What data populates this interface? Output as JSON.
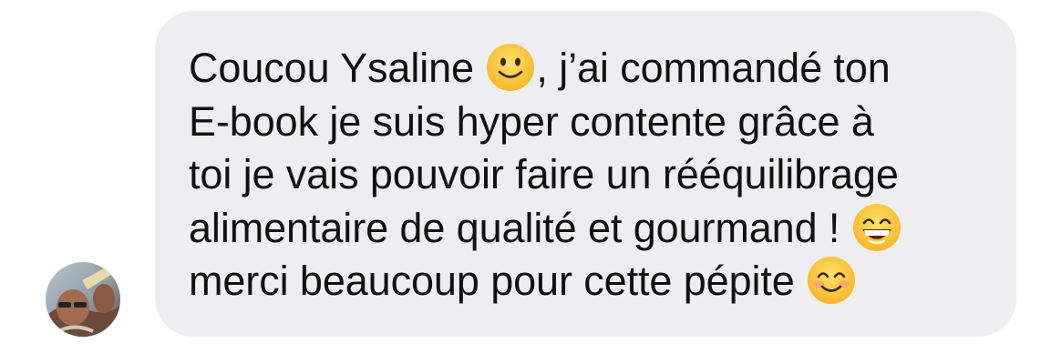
{
  "message": {
    "lines": [
      {
        "before": "Coucou Ysaline ",
        "emoji": "slightly-smiling-face",
        "after": ", j’ai commandé ton"
      },
      {
        "text": "E-book je suis hyper contente grâce à"
      },
      {
        "text": "toi je vais pouvoir faire un rééquilibrage"
      },
      {
        "before": "alimentaire de qualité et gourmand ! ",
        "emoji": "grinning-face-with-smiling-eyes",
        "after": ""
      },
      {
        "before": "merci beaucoup pour cette pépite ",
        "emoji": "smiling-face-with-smiling-eyes",
        "after": ""
      }
    ]
  },
  "sender": {
    "avatar_icon": "user-avatar-photo"
  },
  "colors": {
    "bubble_background": "#eeeef0",
    "text": "#111111",
    "emoji_yellow": "#fcc42c"
  }
}
